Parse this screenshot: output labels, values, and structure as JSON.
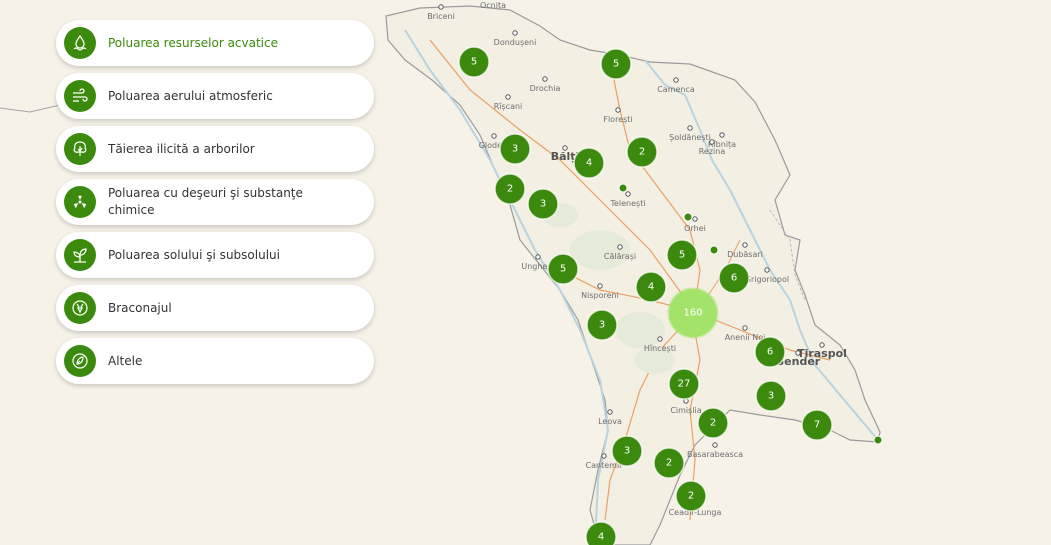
{
  "categories": [
    {
      "label": "Poluarea resurselor acvatice",
      "icon": "water-drop-icon",
      "active": true
    },
    {
      "label": "Poluarea aerului atmosferic",
      "icon": "wind-icon",
      "active": false
    },
    {
      "label": "Tăierea ilicită a arborilor",
      "icon": "tree-icon",
      "active": false
    },
    {
      "label": "Poluarea cu deşeuri şi substanţe chimice",
      "icon": "radiation-icon",
      "active": false
    },
    {
      "label": "Poluarea solului şi subsolului",
      "icon": "sprout-icon",
      "active": false
    },
    {
      "label": "Braconajul",
      "icon": "deer-icon",
      "active": false
    },
    {
      "label": "Altele",
      "icon": "leaf-icon",
      "active": false
    }
  ],
  "map": {
    "cities": [
      "Ocnița",
      "Briceni",
      "Dondușeni",
      "Drochia",
      "Camenca",
      "Rîșcani",
      "Florești",
      "Șoldănești",
      "Rîbnița",
      "Rezina",
      "Glodeni",
      "Bălți",
      "Telenești",
      "Orhei",
      "Dubăsari",
      "Călărași",
      "Ungheni",
      "Grigoriopol",
      "Nisporeni",
      "Anenii Noi",
      "Tiraspol",
      "Bender",
      "Hîncești",
      "Cimișlia",
      "Leova",
      "Basarabeasca",
      "Cantemir",
      "Ceadîr-Lunga"
    ],
    "clusters": [
      5,
      5,
      3,
      4,
      2,
      2,
      3,
      5,
      5,
      6,
      4,
      160,
      3,
      6,
      27,
      3,
      2,
      7,
      3,
      2,
      2,
      4
    ],
    "colors": {
      "cluster": "#3b8a0d",
      "cluster_large": "#a4e36a",
      "accent": "#3b8a0d"
    }
  }
}
